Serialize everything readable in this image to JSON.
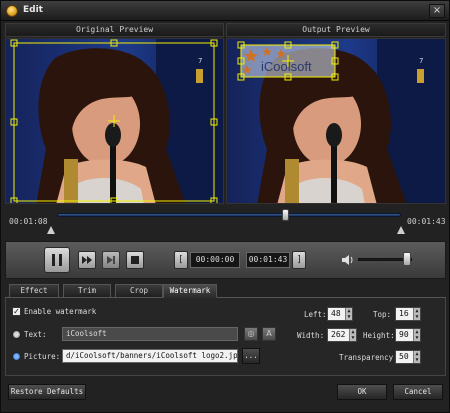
{
  "window": {
    "title": "Edit",
    "close": "×"
  },
  "panes": {
    "original": "Original Preview",
    "output": "Output Preview"
  },
  "watermark_text": "iCoolsoft",
  "timeline": {
    "start": "00:01:08",
    "end": "00:01:43",
    "position": 0.66
  },
  "controls": {
    "pause_icon": "pause-icon",
    "current_time": "00:00:00",
    "end_time": "00:01:43",
    "left_bracket": "[",
    "right_bracket": "]",
    "volume": 0.9
  },
  "tabs": [
    {
      "label": "Effect"
    },
    {
      "label": "Trim"
    },
    {
      "label": "Crop"
    },
    {
      "label": "Watermark",
      "active": true
    }
  ],
  "watermark": {
    "enable_label": "Enable watermark",
    "enabled": true,
    "text_label": "Text:",
    "text_value": "iCoolsoft",
    "picture_label": "Picture:",
    "picture_value": "d/iCoolsoft/banners/iCoolsoft logo2.jpg",
    "browse_label": "...",
    "left_label": "Left:",
    "left_value": "48",
    "top_label": "Top:",
    "top_value": "16",
    "width_label": "Width:",
    "width_value": "262",
    "height_label": "Height:",
    "height_value": "90",
    "transparency_label": "Transparency:",
    "transparency_value": "50"
  },
  "buttons": {
    "restore": "Restore Defaults",
    "ok": "OK",
    "cancel": "Cancel"
  },
  "colors": {
    "selection": "#f2f000",
    "accent": "#3a5a90",
    "radio_selected": "#2f6fd0"
  }
}
